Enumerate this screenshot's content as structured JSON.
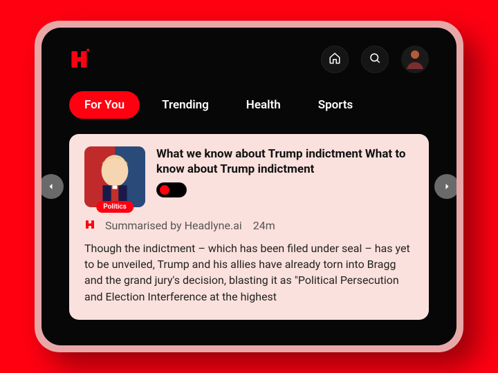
{
  "nav": {
    "tabs": [
      "For You",
      "Trending",
      "Health",
      "Sports"
    ],
    "active_index": 0
  },
  "article": {
    "category": "Politics",
    "headline": "What we know about Trump indictment What to know about Trump indictment",
    "source_line": "Summarised by Headlyne.ai",
    "time_ago": "24m",
    "body": "Though the indictment – which has been filed under seal – has yet to be unveiled, Trump and his allies have already torn into Bragg and the grand jury's decision, blasting it as \"Political Persecution and Election Interference at the highest"
  },
  "colors": {
    "accent": "#ff0011",
    "screen_bg": "#070707",
    "card_bg": "#fbe1dd"
  }
}
